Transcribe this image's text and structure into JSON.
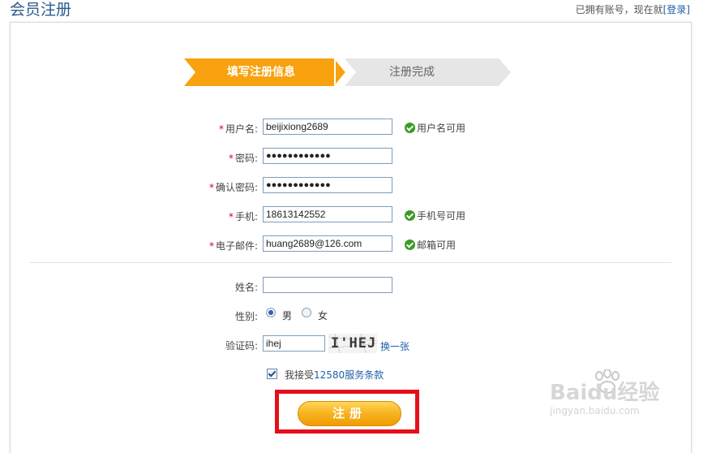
{
  "header": {
    "title": "会员注册",
    "login_prefix": "已拥有账号，现在就",
    "login_link": "[登录]"
  },
  "steps": [
    {
      "label": "填写注册信息",
      "active": true,
      "color": "#f7a20e"
    },
    {
      "label": "注册完成",
      "active": false,
      "color": "#e6e6e6"
    }
  ],
  "form": {
    "username": {
      "label": "用户名:",
      "value": "beijixiong2689",
      "status": "用户名可用"
    },
    "password": {
      "label": "密码:",
      "value": "●●●●●●●●●●●●"
    },
    "confirm_password": {
      "label": "确认密码:",
      "value": "●●●●●●●●●●●●"
    },
    "phone": {
      "label": "手机:",
      "value": "18613142552",
      "status": "手机号可用"
    },
    "email": {
      "label": "电子邮件:",
      "value": "huang2689@126.com",
      "status": "邮箱可用"
    },
    "name": {
      "label": "姓名:",
      "value": ""
    },
    "gender": {
      "label": "性别:",
      "options": [
        "男",
        "女"
      ],
      "selected": "男"
    },
    "captcha": {
      "label": "验证码:",
      "value": "ihej",
      "image_text": "I'HEJ",
      "change_link": "换一张"
    },
    "required_mark": "*"
  },
  "agree": {
    "checked": true,
    "prefix": "我接受",
    "terms_link": "12580服务条款"
  },
  "submit_label": "注册",
  "watermark": {
    "brand": "Baidu经验",
    "url": "jingyan.baidu.com"
  },
  "colors": {
    "accent": "#f7a20e",
    "link": "#1f5fa8",
    "ok": "#3a9b24",
    "highlight": "#e3101b"
  }
}
